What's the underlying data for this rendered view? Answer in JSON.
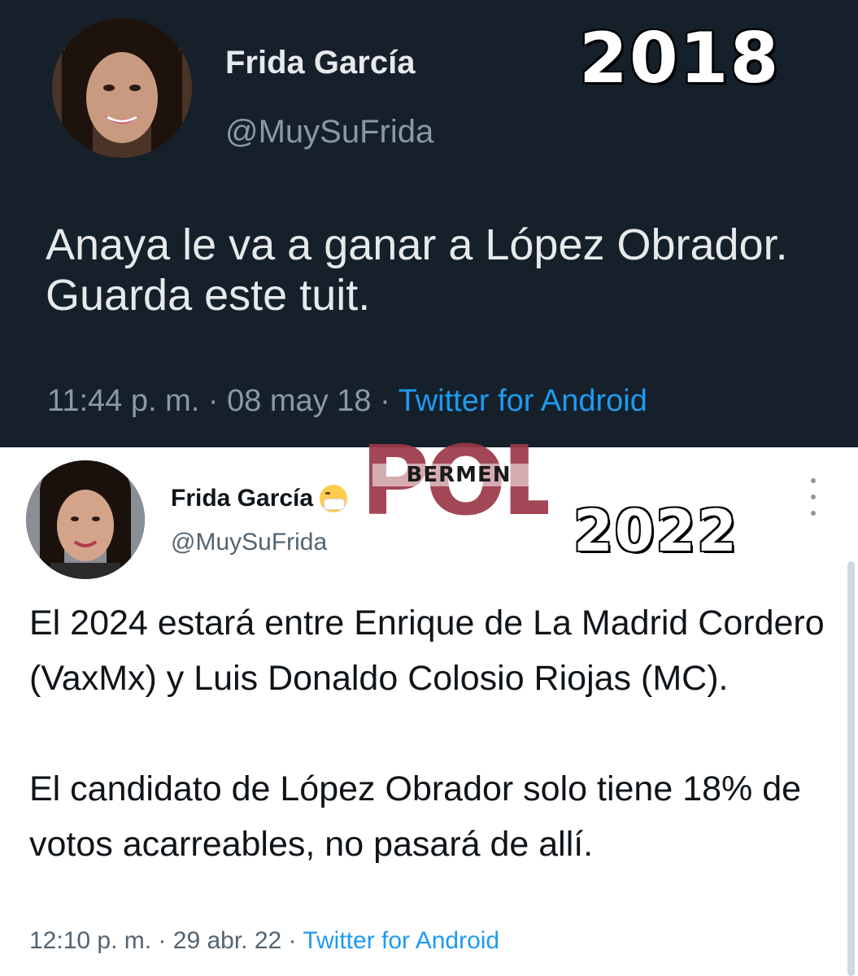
{
  "tweet_2018": {
    "year_label": "2018",
    "display_name": "Frida García",
    "handle": "@MuySuFrida",
    "text": "Anaya le va a ganar a López Obrador. Guarda este tuit.",
    "time": "11:44 p. m.",
    "separator": " · ",
    "date": "08 may 18",
    "source": "Twitter for Android",
    "colors": {
      "background": "#15202b",
      "text": "#e7e9ea",
      "muted": "#8b98a5",
      "link": "#1d9bf0"
    }
  },
  "tweet_2022": {
    "year_label": "2022",
    "display_name": "Frida García",
    "name_emoji_icon": "face-with-medical-mask-icon",
    "handle": "@MuySuFrida",
    "text": "El 2024 estará entre Enrique de La Madrid Cordero (VaxMx) y Luis Donaldo Colosio Riojas (MC).\n\nEl candidato de López Obrador solo tiene 18% de votos acarreables, no pasará de allí.",
    "time": "12:10 p. m.",
    "separator": " · ",
    "date": "29 abr. 22",
    "source": "Twitter for Android",
    "colors": {
      "background": "#ffffff",
      "text": "#0f1419",
      "muted": "#536471",
      "link": "#1d9bf0"
    }
  },
  "watermark": {
    "big_text": "POL",
    "small_text": "BERMEN",
    "colors": {
      "big": "#9c3848",
      "small": "#1a1a1a"
    }
  }
}
